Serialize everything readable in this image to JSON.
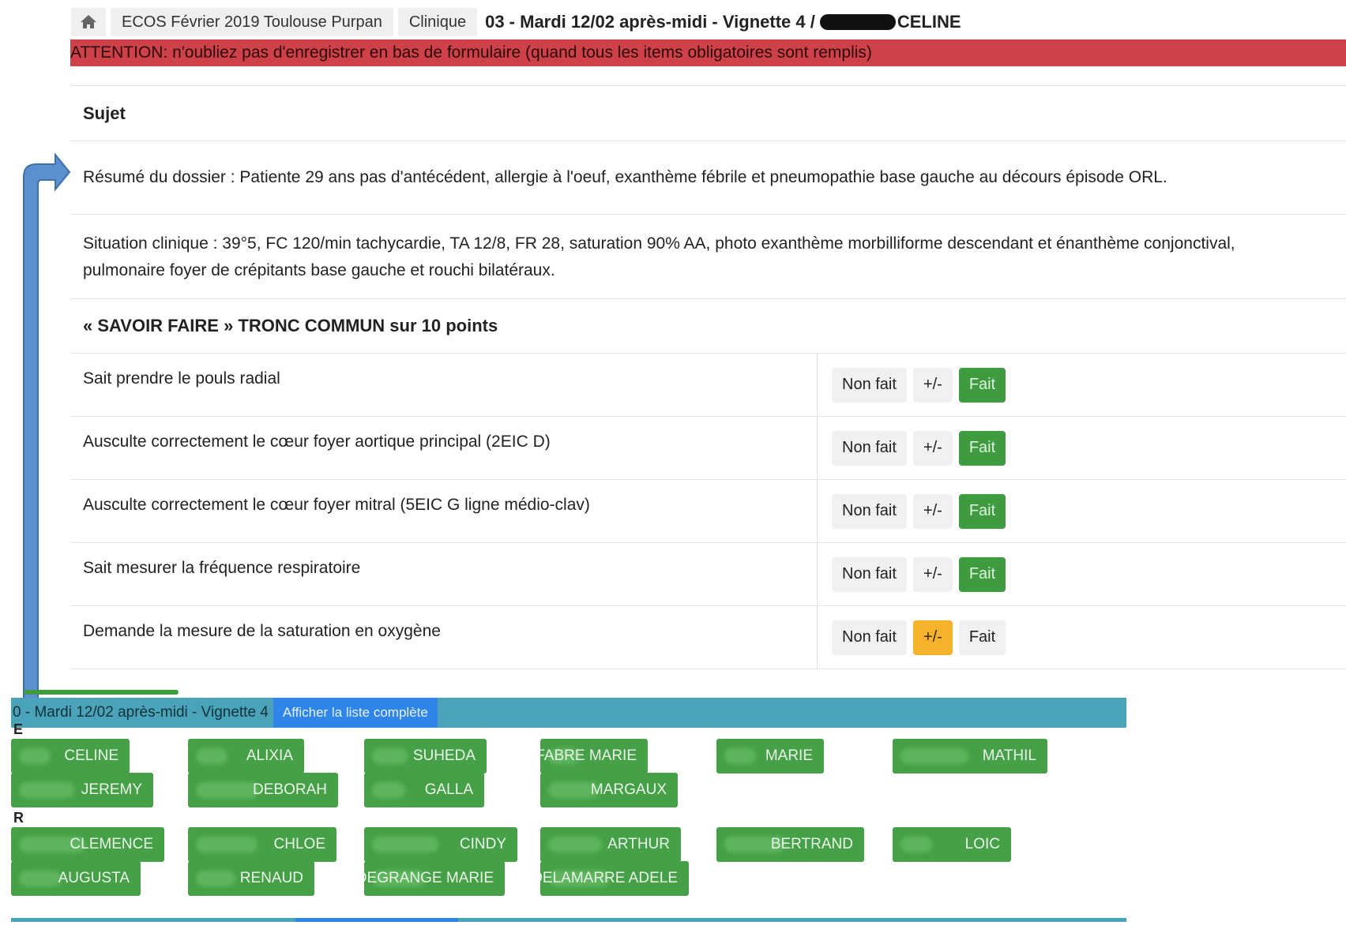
{
  "header": {
    "home_icon": "home-icon",
    "crumbs": [
      "ECOS Février 2019 Toulouse Purpan",
      "Clinique"
    ],
    "title_prefix": "03 - Mardi 12/02 après-midi - Vignette 4 /",
    "title_suffix": "CELINE"
  },
  "alert": {
    "text": "ATTENTION: n'oubliez pas d'enregistrer en bas de formulaire (quand tous les items obligatoires sont remplis)",
    "color": "#cf4148"
  },
  "form": {
    "sujet_title": "Sujet",
    "resume": "Résumé du dossier : Patiente 29 ans pas d'antécédent, allergie à l'oeuf, exanthème fébrile et pneumopathie base gauche au décours épisode ORL.",
    "situation_line1": "Situation clinique : 39°5, FC 120/min tachycardie, TA 12/8, FR 28, saturation 90% AA, photo exanthème morbilliforme descendant et énanthème conjonctival,",
    "situation_line2": "pulmonaire foyer de crépitants base gauche et rouchi bilatéraux.",
    "section_title": "« SAVOIR FAIRE » TRONC COMMUN sur 10 points",
    "button_labels": {
      "non_fait": "Non fait",
      "partial": "+/-",
      "fait": "Fait"
    },
    "items": [
      {
        "label": "Sait prendre le pouls radial",
        "selected": "fait"
      },
      {
        "label": "Ausculte correctement le cœur foyer aortique principal (2EIC D)",
        "selected": "fait"
      },
      {
        "label": "Ausculte correctement le cœur foyer mitral (5EIC G ligne médio-clav)",
        "selected": "fait"
      },
      {
        "label": "Sait mesurer la fréquence respiratoire",
        "selected": "fait"
      },
      {
        "label": "Demande la mesure de la saturation en oxygène",
        "selected": "partial"
      }
    ],
    "colors": {
      "fait": "#3e9b3f",
      "partial": "#f4b32b"
    }
  },
  "students_panel": {
    "bar_label": "0 - Mardi 12/02 après-midi - Vignette 4",
    "show_all": "Afficher la liste complète",
    "groups": [
      {
        "letter": "E",
        "names": [
          "CELINE",
          "ALIXIA",
          "SUHEDA",
          "FABRE MARIE",
          "MARIE",
          "MATHIL",
          "JEREMY",
          "DEBORAH",
          "GALLA",
          "MARGAUX"
        ]
      },
      {
        "letter": "R",
        "names": [
          "CLEMENCE",
          "CHLOE",
          "CINDY",
          "ARTHUR",
          "BERTRAND",
          "LOIC",
          "AUGUSTA",
          "RENAUD",
          "DEGRANGE MARIE",
          "DELAMARRE ADELE"
        ]
      }
    ],
    "chip_color": "#45a047",
    "bar_color": "#4aa3b8"
  }
}
